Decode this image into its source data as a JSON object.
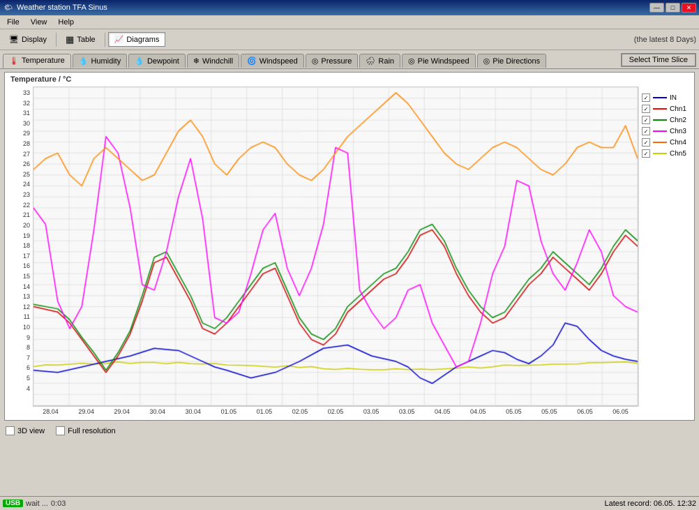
{
  "titleBar": {
    "icon": "🌤",
    "title": "Weather station TFA Sinus",
    "minimizeLabel": "—",
    "maximizeLabel": "□",
    "closeLabel": "✕"
  },
  "menuBar": {
    "items": [
      "File",
      "View",
      "Help"
    ]
  },
  "toolbar": {
    "buttons": [
      {
        "label": "Display",
        "icon": "🖥",
        "active": false
      },
      {
        "label": "Table",
        "icon": "▦",
        "active": false
      },
      {
        "label": "Diagrams",
        "icon": "📈",
        "active": true
      }
    ],
    "rightText": "(the latest 8 Days)"
  },
  "tabs": {
    "items": [
      {
        "label": "Temperature",
        "icon": "🌡"
      },
      {
        "label": "Humidity",
        "icon": "💧"
      },
      {
        "label": "Dewpoint",
        "icon": "💧"
      },
      {
        "label": "Windchill",
        "icon": "❄"
      },
      {
        "label": "Windspeed",
        "icon": "🌀"
      },
      {
        "label": "Pressure",
        "icon": "⊙"
      },
      {
        "label": "Rain",
        "icon": "🌧"
      },
      {
        "label": "Pie Windspeed",
        "icon": "⊙"
      },
      {
        "label": "Pie Directions",
        "icon": "⊙"
      }
    ],
    "activeIndex": 0,
    "selectTimeBtn": "Select Time Slice"
  },
  "chart": {
    "title": "Temperature / °C",
    "yAxis": {
      "max": 33,
      "min": 4,
      "labels": [
        "33",
        "32",
        "31",
        "30",
        "29",
        "28",
        "27",
        "26",
        "25",
        "24",
        "23",
        "22",
        "21",
        "20",
        "19",
        "18",
        "17",
        "16",
        "15",
        "14",
        "13",
        "12",
        "11",
        "10",
        "9",
        "8",
        "7",
        "6",
        "5",
        "4"
      ]
    },
    "xAxis": {
      "labels": [
        "28.04",
        "29.04",
        "29.04",
        "30.04",
        "30.04",
        "01.05",
        "01.05",
        "02.05",
        "02.05",
        "03.05",
        "03.05",
        "04.05",
        "04.05",
        "05.05",
        "05.05",
        "06.05",
        "06.05"
      ]
    },
    "legend": {
      "items": [
        {
          "label": "IN",
          "color": "#0000cc",
          "checked": true
        },
        {
          "label": "Chn1",
          "color": "#ff0000",
          "checked": true
        },
        {
          "label": "Chn2",
          "color": "#008800",
          "checked": true
        },
        {
          "label": "Chn3",
          "color": "#ff00ff",
          "checked": true
        },
        {
          "label": "Chn4",
          "color": "#ff6600",
          "checked": true
        },
        {
          "label": "Chn5",
          "color": "#cccc00",
          "checked": true
        }
      ]
    }
  },
  "bottomControls": {
    "checkboxes": [
      {
        "label": "3D view",
        "checked": false
      },
      {
        "label": "Full resolution",
        "checked": false
      }
    ]
  },
  "statusBar": {
    "usbLabel": "USB",
    "waitText": "wait ...",
    "timer": "0:03",
    "latestRecord": "Latest record: 06.05. 12:32"
  }
}
